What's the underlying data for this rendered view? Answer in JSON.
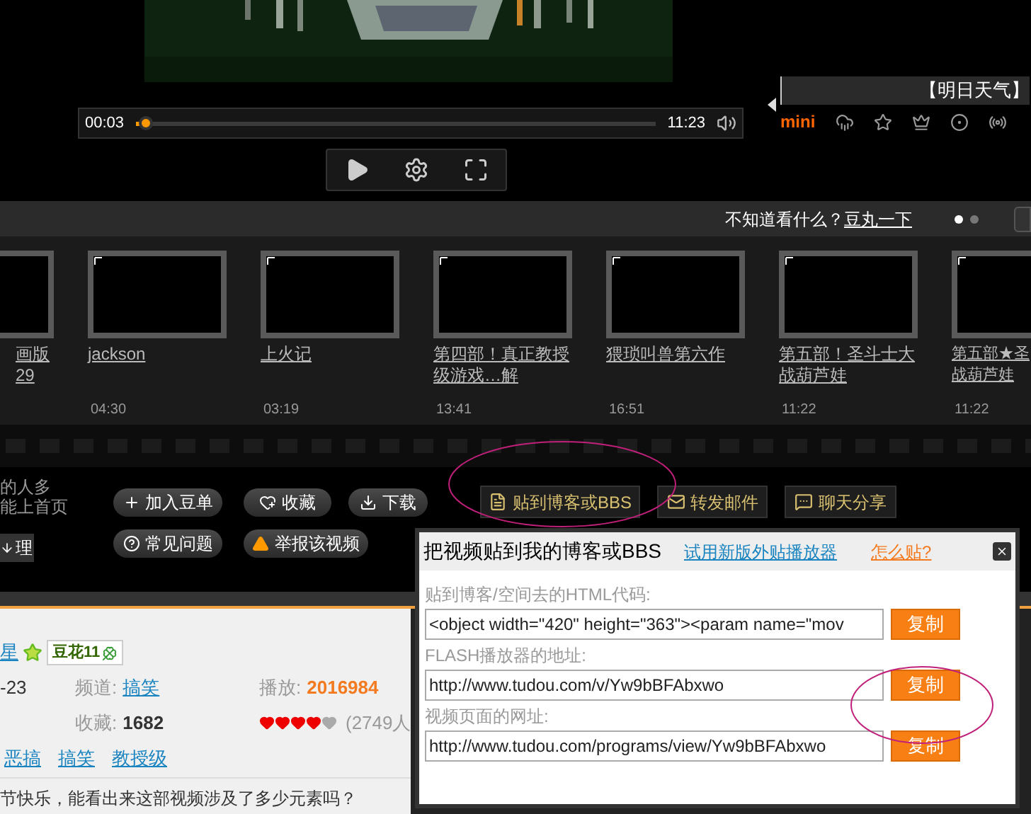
{
  "player": {
    "elapsed": "00:03",
    "duration": "11:23",
    "level": 0.02
  },
  "weather_widget": {
    "title": "【明日天气】",
    "label": "mini"
  },
  "recommend_bar": {
    "prompt": "不知道看什么？",
    "link": "豆丸一下",
    "pages": [
      {
        "selected": true
      },
      {
        "selected": false
      }
    ]
  },
  "related_videos": [
    {
      "title": "画版29"
    },
    {
      "title": "jackson",
      "duration": "04:30"
    },
    {
      "title": "上火记",
      "duration": "03:19"
    },
    {
      "title": "第四部！真正教授级游戏…解",
      "duration": "13:41"
    },
    {
      "title": "猥琐叫兽第六作",
      "duration": "16:51"
    },
    {
      "title": "第五部！圣斗士大战葫芦娃",
      "duration": "11:22"
    },
    {
      "title": "第五部★圣战葫芦娃",
      "duration": "11:22"
    }
  ],
  "notes": [
    "的人多",
    "能上首页"
  ],
  "side_button": "理",
  "actions": [
    {
      "label": "加入豆单",
      "kind": "round"
    },
    {
      "label": "收藏",
      "kind": "round"
    },
    {
      "label": "下载",
      "kind": "round"
    },
    {
      "label": "贴到博客或BBS",
      "kind": "square"
    },
    {
      "label": "转发邮件",
      "kind": "square"
    },
    {
      "label": "聊天分享",
      "kind": "square"
    }
  ],
  "actions_2": [
    {
      "label": "常见问题",
      "kind": "round"
    },
    {
      "label": "举报该视频",
      "kind": "round"
    }
  ],
  "info": {
    "uploader": "星",
    "badge": "豆花11",
    "date": "-23",
    "fields": [
      {
        "label": "频道:",
        "value": "搞笑",
        "kind": "link"
      },
      {
        "label": "播放:",
        "value": "2016984",
        "kind": "count"
      },
      {
        "label": "收藏:",
        "value": "1682",
        "kind": "number"
      }
    ],
    "rating": {
      "stars": 4,
      "votes": "(2749人"
    },
    "tags": [
      "恶搞",
      "搞笑",
      "教授级"
    ],
    "description": "节快乐，能看出来这部视频涉及了多少元素吗？"
  },
  "popup": {
    "title": "把视频贴到我的博客或BBS",
    "try_link": "试用新版外贴播放器",
    "help_link": "怎么贴?",
    "fields": [
      {
        "label": "贴到博客/空间去的HTML代码:",
        "value": "<object width=\"420\" height=\"363\"><param name=\"mov",
        "button": "复制"
      },
      {
        "label": "FLASH播放器的地址:",
        "value": "http://www.tudou.com/v/Yw9bBFAbxwo",
        "button": "复制"
      },
      {
        "label": "视频页面的网址:",
        "value": "http://www.tudou.com/programs/view/Yw9bBFAbxwo",
        "button": "复制"
      }
    ]
  }
}
